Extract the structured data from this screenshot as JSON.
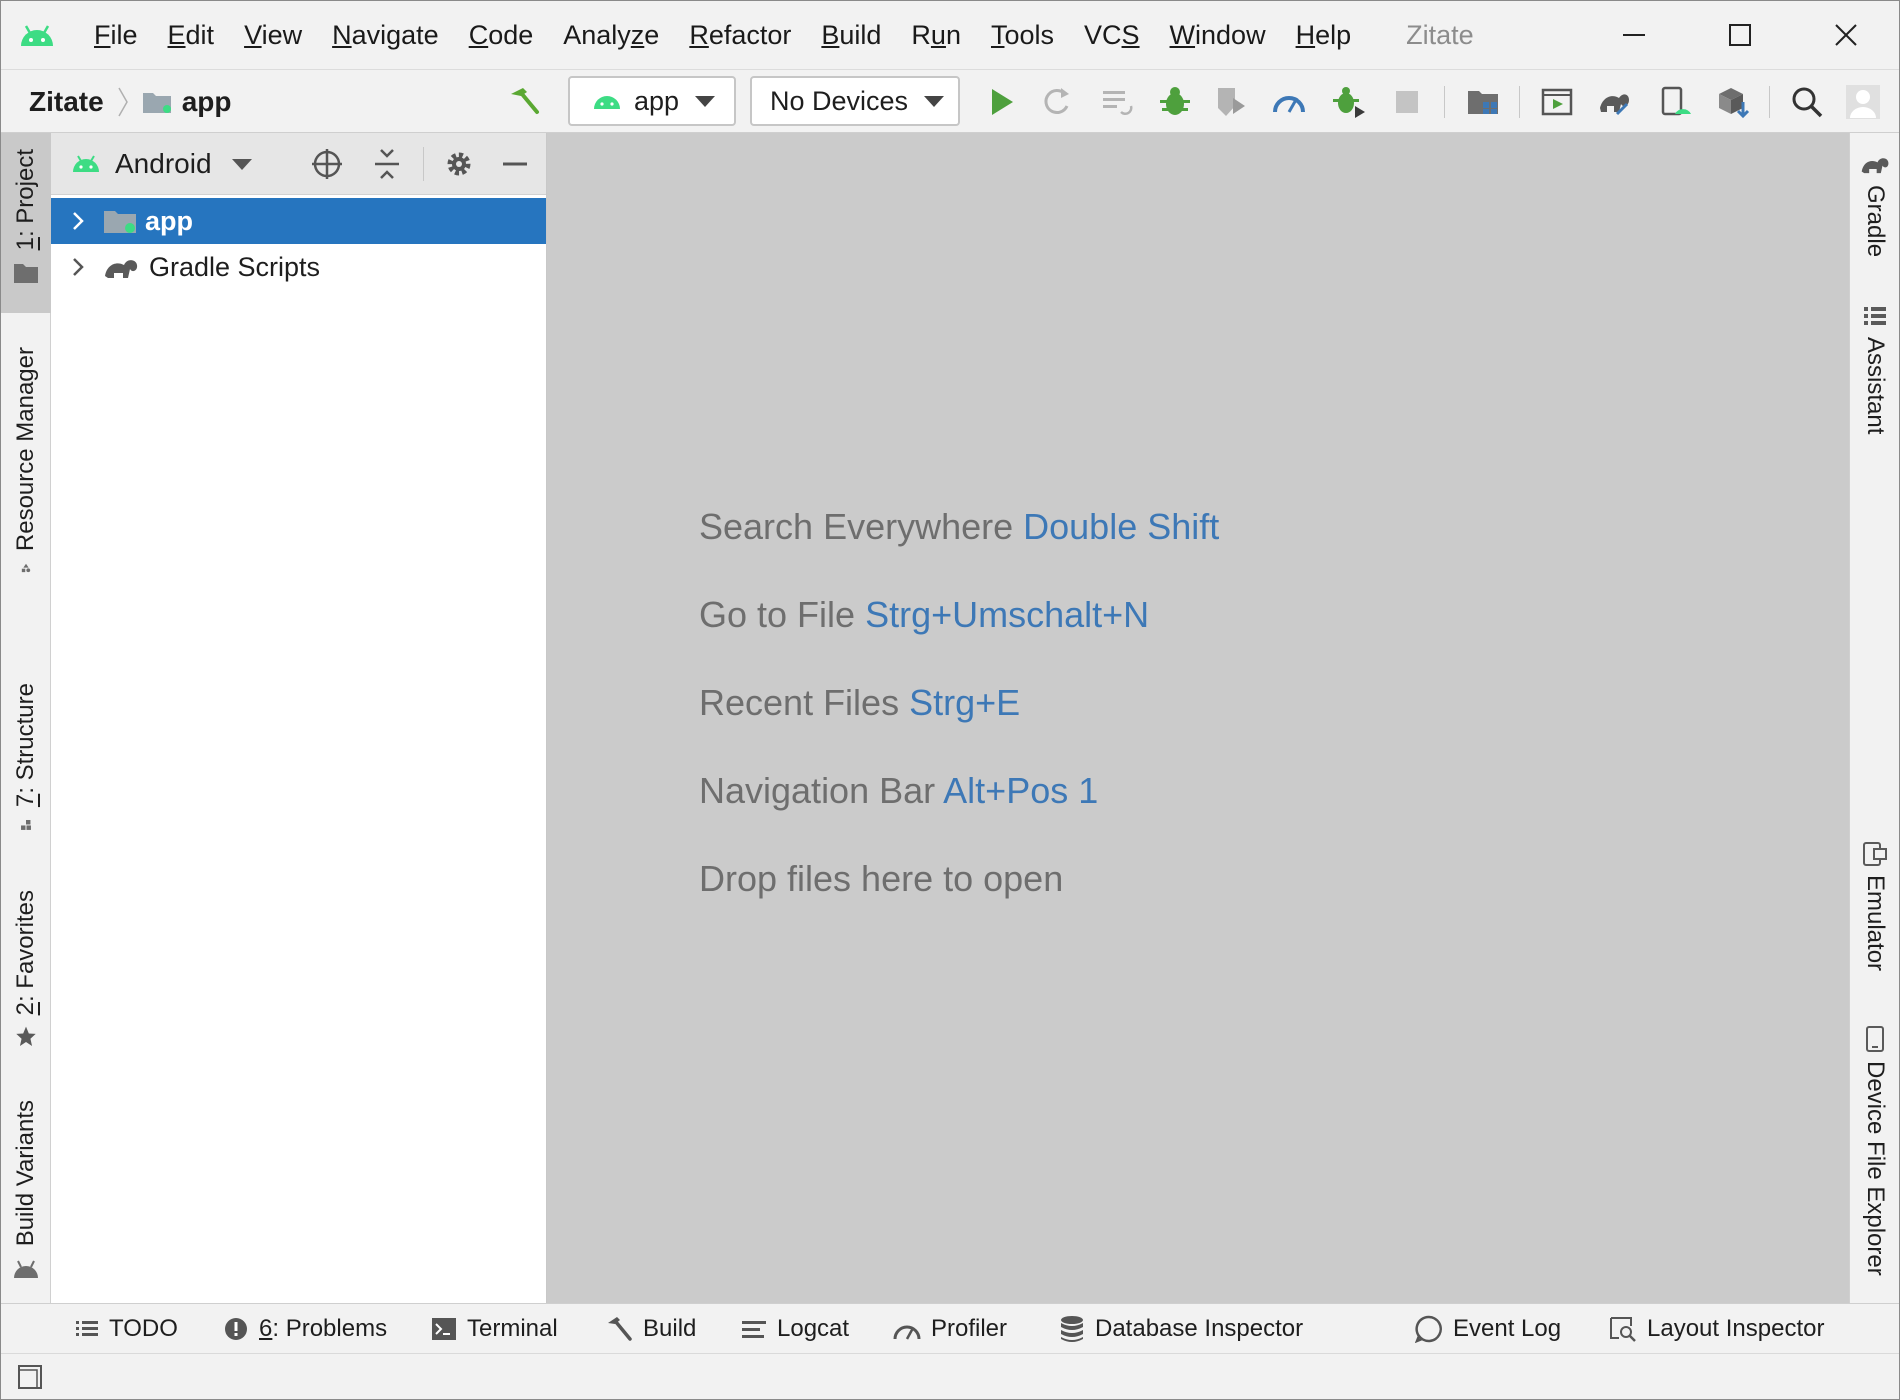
{
  "menubar": {
    "items": [
      {
        "mnemonic": "F",
        "rest": "ile"
      },
      {
        "mnemonic": "E",
        "rest": "dit"
      },
      {
        "mnemonic": "V",
        "rest": "iew"
      },
      {
        "mnemonic": "N",
        "rest": "avigate"
      },
      {
        "mnemonic": "C",
        "rest": "ode"
      },
      {
        "pre": "Analy",
        "mnemonic": "z",
        "rest": "e"
      },
      {
        "mnemonic": "R",
        "rest": "efactor"
      },
      {
        "mnemonic": "B",
        "rest": "uild"
      },
      {
        "pre": "R",
        "mnemonic": "u",
        "rest": "n"
      },
      {
        "mnemonic": "T",
        "rest": "ools"
      },
      {
        "pre": "VC",
        "mnemonic": "S",
        "rest": ""
      },
      {
        "mnemonic": "W",
        "rest": "indow"
      },
      {
        "mnemonic": "H",
        "rest": "elp"
      }
    ],
    "window_title": "Zitate"
  },
  "breadcrumb": {
    "project": "Zitate",
    "module": "app"
  },
  "toolbar": {
    "run_config": "app",
    "device": "No Devices"
  },
  "left_tabs": {
    "project": {
      "num": "1",
      "label": ": Project"
    },
    "resource_manager": "Resource Manager",
    "structure": {
      "num": "7",
      "label": ": Structure"
    },
    "favorites": {
      "num": "2",
      "label": ": Favorites"
    },
    "build_variants": "Build Variants"
  },
  "right_tabs": {
    "gradle": "Gradle",
    "assistant": "Assistant",
    "emulator": "Emulator",
    "device_file_explorer": "Device File Explorer"
  },
  "project_panel": {
    "view": "Android",
    "tree": [
      {
        "label": "app",
        "selected": true
      },
      {
        "label": "Gradle Scripts",
        "selected": false
      }
    ]
  },
  "editor": {
    "hints": [
      {
        "text": "Search Everywhere ",
        "key": "Double Shift"
      },
      {
        "text": "Go to File ",
        "key": "Strg+Umschalt+N"
      },
      {
        "text": "Recent Files ",
        "key": "Strg+E"
      },
      {
        "text": "Navigation Bar ",
        "key": "Alt+Pos 1"
      },
      {
        "text": "Drop files here to open",
        "key": ""
      }
    ]
  },
  "bottom_tools": {
    "todo": "TODO",
    "problems": {
      "num": "6",
      "label": ": Problems"
    },
    "terminal": "Terminal",
    "build": "Build",
    "logcat": "Logcat",
    "profiler": "Profiler",
    "database_inspector": "Database Inspector",
    "event_log": "Event Log",
    "layout_inspector": "Layout Inspector"
  },
  "colors": {
    "android_green": "#3ddc84",
    "selection_blue": "#2675bf",
    "hint_key_blue": "#3d78b6",
    "editor_bg": "#cbcbcb"
  }
}
